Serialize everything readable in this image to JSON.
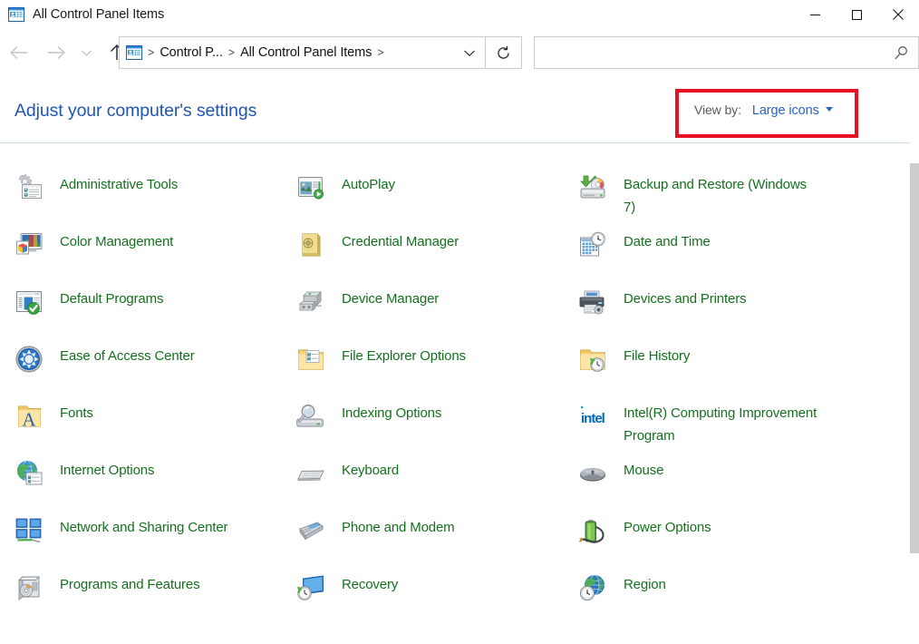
{
  "window": {
    "title": "All Control Panel Items",
    "title_icon": "control-panel-icon",
    "buttons": {
      "minimize": "minimize-icon",
      "maximize": "maximize-icon",
      "close": "close-icon"
    }
  },
  "nav": {
    "back": "back-arrow-icon",
    "forward": "forward-arrow-icon",
    "recent": "recent-locations-icon",
    "up": "up-arrow-icon",
    "refresh": "refresh-icon",
    "breadcrumb": {
      "icon": "control-panel-icon",
      "separator": ">",
      "items": [
        "Control P...",
        "All Control Panel Items"
      ],
      "dropdown": "chevron-down-icon"
    }
  },
  "search": {
    "value": "",
    "placeholder": "",
    "icon": "search-icon"
  },
  "header": {
    "page_title": "Adjust your computer's settings",
    "view_by_label": "View by:",
    "view_by_value": "Large icons",
    "view_by_caret": "chevron-down-icon",
    "highlight_color": "#e81123"
  },
  "colors": {
    "link": "#14701e",
    "heading": "#1f55b5",
    "accent": "#2864bd",
    "highlight": "#e81123"
  },
  "items": {
    "column1": [
      {
        "label": "Administrative Tools",
        "icon": "administrative-tools-icon"
      },
      {
        "label": "Color Management",
        "icon": "color-management-icon"
      },
      {
        "label": "Default Programs",
        "icon": "default-programs-icon"
      },
      {
        "label": "Ease of Access Center",
        "icon": "ease-of-access-icon"
      },
      {
        "label": "Fonts",
        "icon": "fonts-icon"
      },
      {
        "label": "Internet Options",
        "icon": "internet-options-icon"
      },
      {
        "label": "Network and Sharing Center",
        "icon": "network-sharing-icon"
      },
      {
        "label": "Programs and Features",
        "icon": "programs-features-icon"
      }
    ],
    "column2": [
      {
        "label": "AutoPlay",
        "icon": "autoplay-icon"
      },
      {
        "label": "Credential Manager",
        "icon": "credential-manager-icon"
      },
      {
        "label": "Device Manager",
        "icon": "device-manager-icon"
      },
      {
        "label": "File Explorer Options",
        "icon": "file-explorer-options-icon"
      },
      {
        "label": "Indexing Options",
        "icon": "indexing-options-icon"
      },
      {
        "label": "Keyboard",
        "icon": "keyboard-icon"
      },
      {
        "label": "Phone and Modem",
        "icon": "phone-modem-icon"
      },
      {
        "label": "Recovery",
        "icon": "recovery-icon"
      }
    ],
    "column3": [
      {
        "label": "Backup and Restore (Windows 7)",
        "icon": "backup-restore-icon"
      },
      {
        "label": "Date and Time",
        "icon": "date-time-icon"
      },
      {
        "label": "Devices and Printers",
        "icon": "devices-printers-icon"
      },
      {
        "label": "File History",
        "icon": "file-history-icon"
      },
      {
        "label": "Intel(R) Computing Improvement Program",
        "icon": "intel-icon"
      },
      {
        "label": "Mouse",
        "icon": "mouse-icon"
      },
      {
        "label": "Power Options",
        "icon": "power-options-icon"
      },
      {
        "label": "Region",
        "icon": "region-icon"
      }
    ]
  },
  "scrollbar": {
    "orientation": "vertical"
  }
}
